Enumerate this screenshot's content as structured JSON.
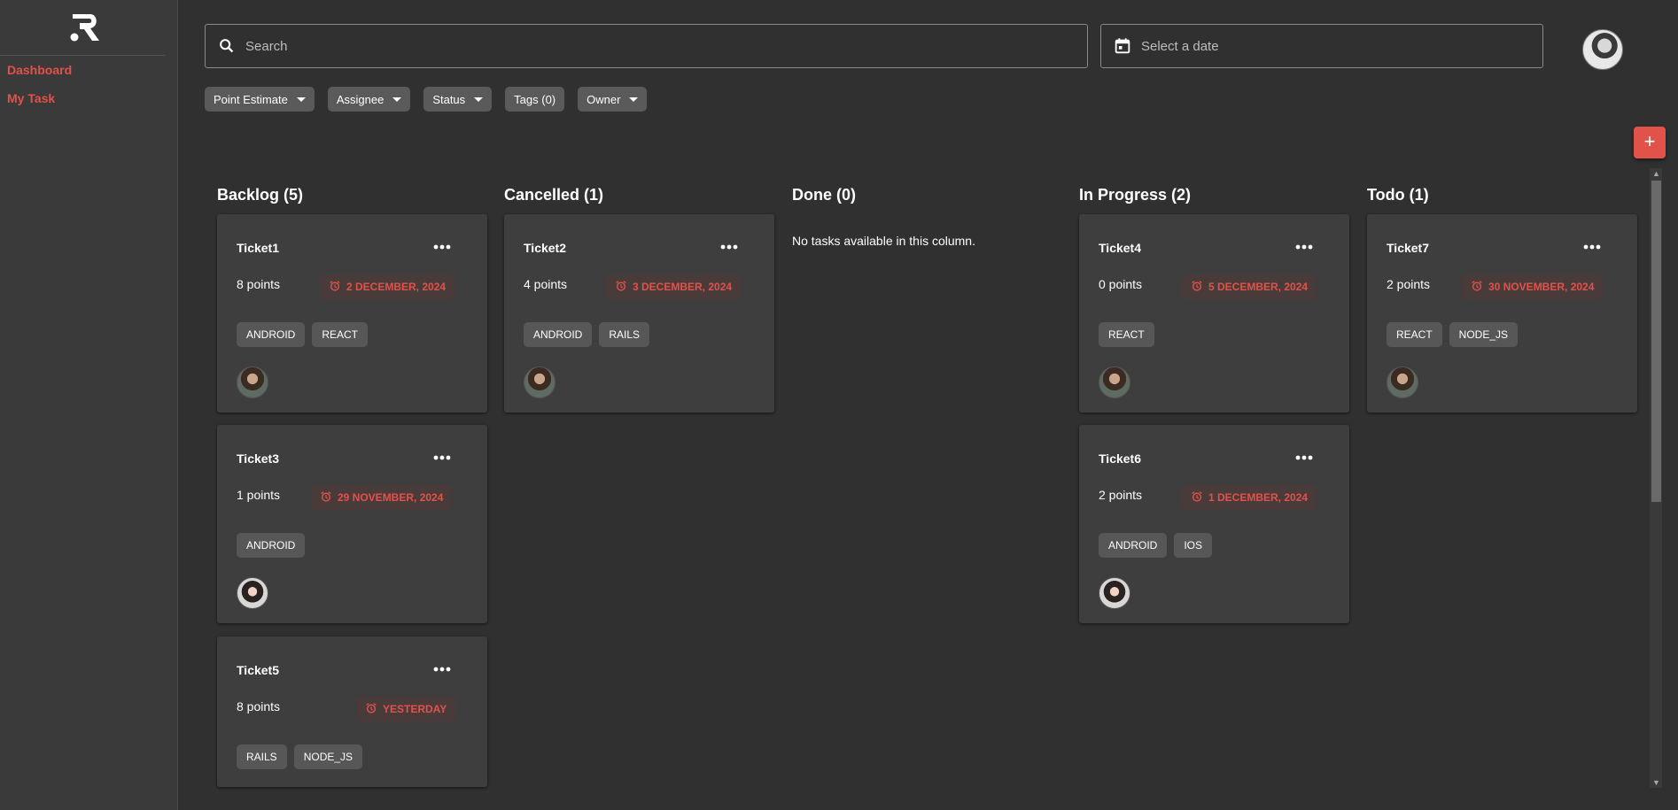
{
  "sidebar": {
    "logo": "R logo",
    "items": [
      {
        "label": "Dashboard"
      },
      {
        "label": "My Task"
      }
    ]
  },
  "header": {
    "search_placeholder": "Search",
    "date_placeholder": "Select a date"
  },
  "filters": [
    "Point Estimate",
    "Assignee",
    "Status",
    "Tags (0)",
    "Owner"
  ],
  "add_button": "+",
  "columns": [
    {
      "title": "Backlog (5)",
      "cards": [
        {
          "name": "Ticket1",
          "points": "8 points",
          "due": "2 DECEMBER, 2024",
          "tags": [
            "ANDROID",
            "REACT"
          ],
          "avatar": "male"
        },
        {
          "name": "Ticket3",
          "points": "1 points",
          "due": "29 NOVEMBER, 2024",
          "tags": [
            "ANDROID"
          ],
          "avatar": "female"
        },
        {
          "name": "Ticket5",
          "points": "8 points",
          "due": "YESTERDAY",
          "tags": [
            "RAILS",
            "NODE_JS"
          ],
          "avatar": "none"
        }
      ]
    },
    {
      "title": "Cancelled (1)",
      "cards": [
        {
          "name": "Ticket2",
          "points": "4 points",
          "due": "3 DECEMBER, 2024",
          "tags": [
            "ANDROID",
            "RAILS"
          ],
          "avatar": "male"
        }
      ]
    },
    {
      "title": "Done (0)",
      "empty_text": "No tasks available in this column.",
      "cards": []
    },
    {
      "title": "In Progress (2)",
      "cards": [
        {
          "name": "Ticket4",
          "points": "0 points",
          "due": "5 DECEMBER, 2024",
          "tags": [
            "REACT"
          ],
          "avatar": "male"
        },
        {
          "name": "Ticket6",
          "points": "2 points",
          "due": "1 DECEMBER, 2024",
          "tags": [
            "ANDROID",
            "IOS"
          ],
          "avatar": "female"
        }
      ]
    },
    {
      "title": "Todo (1)",
      "cards": [
        {
          "name": "Ticket7",
          "points": "2 points",
          "due": "30 NOVEMBER, 2024",
          "tags": [
            "REACT",
            "NODE_JS"
          ],
          "avatar": "male"
        }
      ]
    }
  ],
  "colors": {
    "accent": "#e0524a",
    "background": "#303030",
    "card": "#3e3e3e",
    "sidebar": "#3a3a3a"
  }
}
